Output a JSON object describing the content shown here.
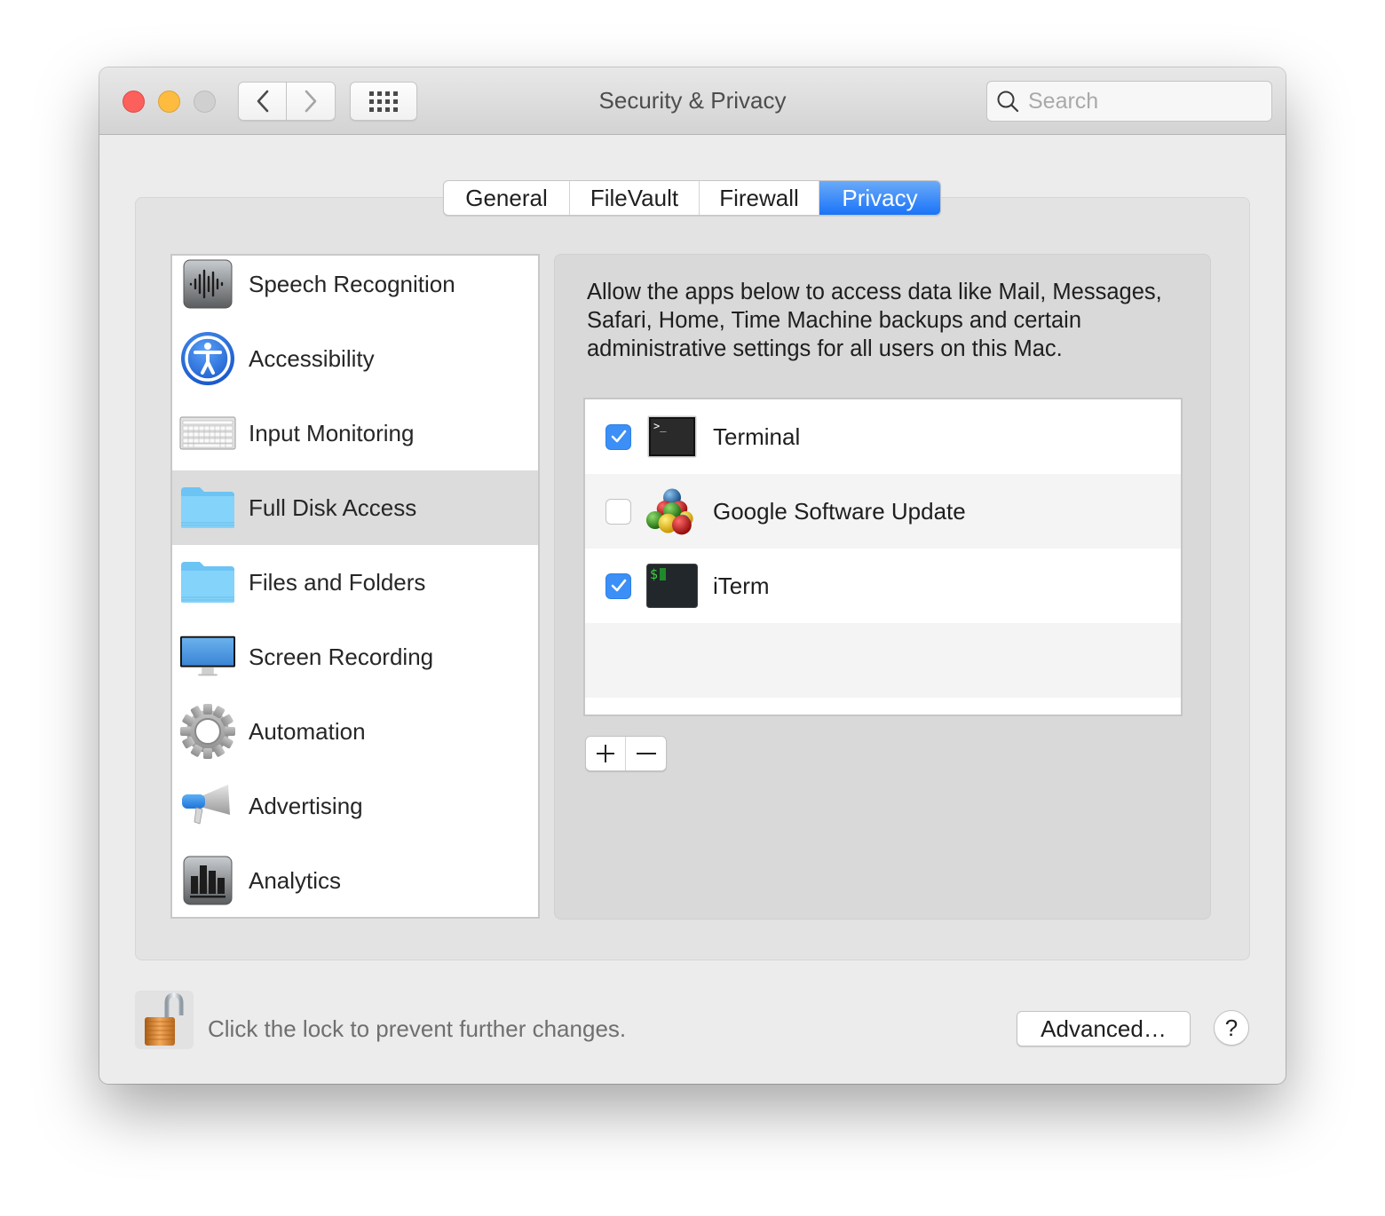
{
  "window": {
    "title": "Security & Privacy",
    "search_placeholder": "Search",
    "search_value": ""
  },
  "tabs": [
    {
      "label": "General",
      "active": false
    },
    {
      "label": "FileVault",
      "active": false
    },
    {
      "label": "Firewall",
      "active": false
    },
    {
      "label": "Privacy",
      "active": true
    }
  ],
  "categories": [
    {
      "label": "Speech Recognition",
      "icon": "speech-waveform-icon",
      "selected": false
    },
    {
      "label": "Accessibility",
      "icon": "accessibility-icon",
      "selected": false
    },
    {
      "label": "Input Monitoring",
      "icon": "keyboard-icon",
      "selected": false
    },
    {
      "label": "Full Disk Access",
      "icon": "folder-icon",
      "selected": true
    },
    {
      "label": "Files and Folders",
      "icon": "folder-icon",
      "selected": false
    },
    {
      "label": "Screen Recording",
      "icon": "display-icon",
      "selected": false
    },
    {
      "label": "Automation",
      "icon": "gear-icon",
      "selected": false
    },
    {
      "label": "Advertising",
      "icon": "megaphone-icon",
      "selected": false
    },
    {
      "label": "Analytics",
      "icon": "bar-chart-icon",
      "selected": false
    }
  ],
  "detail": {
    "description": "Allow the apps below to access data like Mail, Messages, Safari, Home, Time Machine backups and certain administrative settings for all users on this Mac.",
    "apps": [
      {
        "name": "Terminal",
        "checked": true,
        "icon": "terminal-icon"
      },
      {
        "name": "Google Software Update",
        "checked": false,
        "icon": "google-software-update-icon"
      },
      {
        "name": "iTerm",
        "checked": true,
        "icon": "iterm-icon"
      }
    ],
    "add_symbol": "+",
    "remove_symbol": "−"
  },
  "footer": {
    "lock_text": "Click the lock to prevent further changes.",
    "lock_state": "unlocked",
    "advanced_label": "Advanced…",
    "help_label": "?"
  },
  "colors": {
    "accent": "#1a74f7",
    "checkbox_on": "#3b8ff6",
    "close": "#fc605c",
    "minimize": "#fdbc40",
    "zoom_disabled": "#d0d0d0"
  }
}
